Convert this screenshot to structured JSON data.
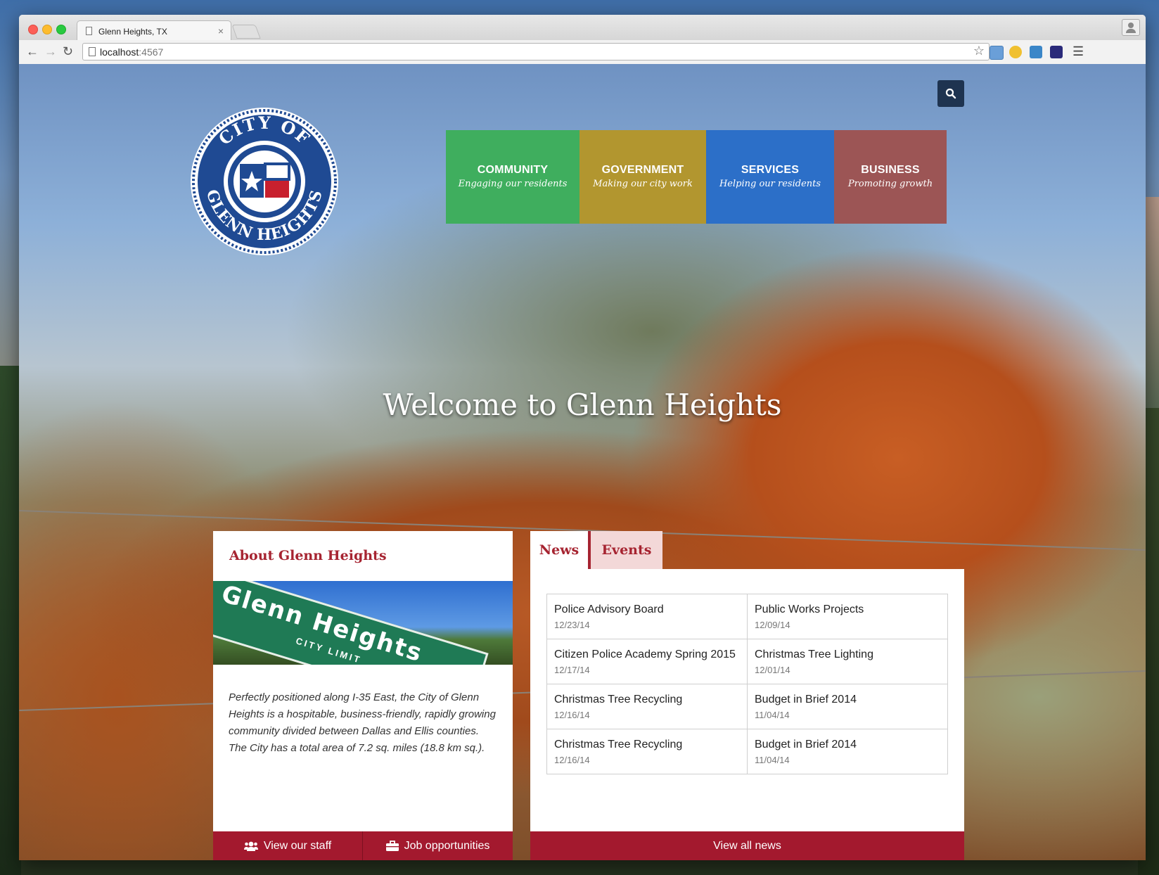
{
  "browser": {
    "tab_title": "Glenn Heights, TX",
    "tab_close": "×",
    "url_host": "localhost",
    "url_port": ":4567"
  },
  "site": {
    "seal_text_top": "CITY OF",
    "seal_text_bottom": "GLENN HEIGHTS",
    "nav": [
      {
        "title": "COMMUNITY",
        "subtitle": "Engaging our residents",
        "color": "#3fae5e"
      },
      {
        "title": "GOVERNMENT",
        "subtitle": "Making our city work",
        "color": "#b2962f"
      },
      {
        "title": "SERVICES",
        "subtitle": "Helping our residents",
        "color": "#2c6fc8"
      },
      {
        "title": "BUSINESS",
        "subtitle": "Promoting growth",
        "color": "#9c5555"
      }
    ],
    "welcome": "Welcome to Glenn Heights"
  },
  "about": {
    "title": "About Glenn Heights",
    "sign_main": "Glenn Heights",
    "sign_sub": "CITY LIMIT",
    "text": "Perfectly positioned along I-35 East, the City of Glenn Heights is a hospitable, business-friendly, rapidly growing community divided between Dallas and Ellis counties. The City has a total area of 7.2 sq. miles (18.8 km sq.).",
    "staff_label": "View our staff",
    "jobs_label": "Job opportunities"
  },
  "news": {
    "tab_news": "News",
    "tab_events": "Events",
    "rows": [
      [
        {
          "title": "Police Advisory Board",
          "date": "12/23/14"
        },
        {
          "title": "Public Works Projects",
          "date": "12/09/14"
        }
      ],
      [
        {
          "title": "Citizen Police Academy Spring 2015",
          "date": "12/17/14"
        },
        {
          "title": "Christmas Tree Lighting",
          "date": "12/01/14"
        }
      ],
      [
        {
          "title": "Christmas Tree Recycling",
          "date": "12/16/14"
        },
        {
          "title": "Budget in Brief 2014",
          "date": "11/04/14"
        }
      ],
      [
        {
          "title": "Christmas Tree Recycling",
          "date": "12/16/14"
        },
        {
          "title": "Budget in Brief 2014",
          "date": "11/04/14"
        }
      ]
    ],
    "view_all": "View all news"
  },
  "colors": {
    "accent_red": "#a3192e",
    "search_bg": "#1e3350"
  },
  "icons": [
    "search-icon",
    "users-icon",
    "briefcase-icon",
    "star-icon",
    "menu-icon"
  ]
}
